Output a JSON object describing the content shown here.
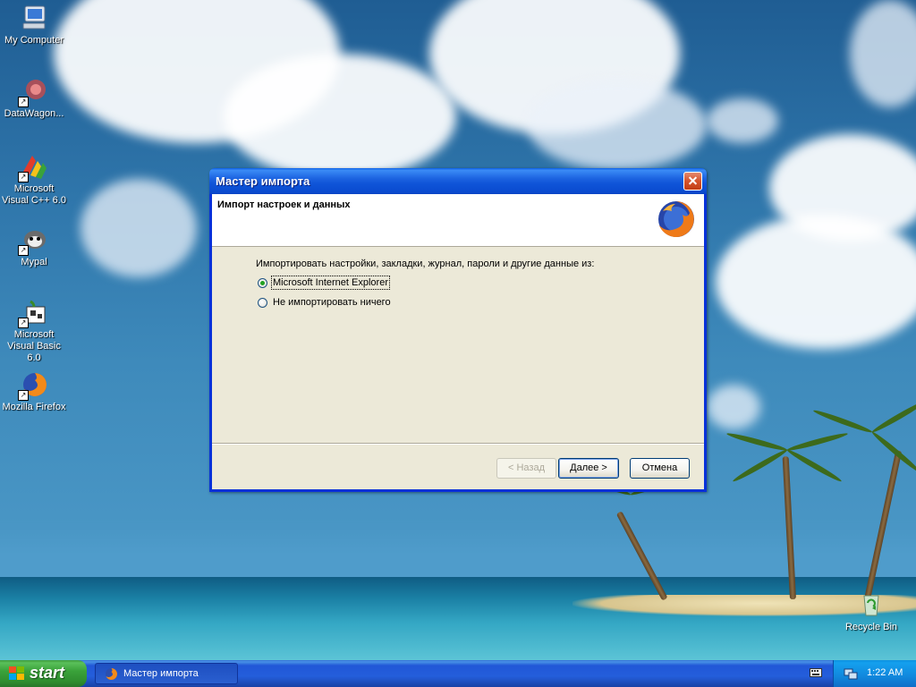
{
  "desktop": {
    "icons": [
      {
        "label": "My Computer",
        "icon": "my-computer-icon"
      },
      {
        "label": "DataWagon...",
        "icon": "datawagon-icon"
      },
      {
        "label": "Microsoft Visual C++ 6.0",
        "icon": "visual-cpp-icon"
      },
      {
        "label": "Mypal",
        "icon": "mypal-icon"
      },
      {
        "label": "Microsoft Visual Basic 6.0",
        "icon": "visual-basic-icon"
      },
      {
        "label": "Mozilla Firefox",
        "icon": "firefox-icon"
      },
      {
        "label": "Recycle Bin",
        "icon": "recycle-bin-icon"
      }
    ]
  },
  "dialog": {
    "title": "Мастер импорта",
    "header_title": "Импорт настроек и данных",
    "prompt": "Импортировать настройки, закладки, журнал, пароли и другие данные из:",
    "options": [
      {
        "label": "Microsoft Internet Explorer",
        "selected": true
      },
      {
        "label": "Не импортировать ничего",
        "selected": false
      }
    ],
    "buttons": {
      "back": "< Назад",
      "next": "Далее >",
      "cancel": "Отмена"
    }
  },
  "taskbar": {
    "start_label": "start",
    "task_label": "Мастер импорта",
    "clock": "1:22 AM"
  },
  "colors": {
    "title_bar": "#0a4bd0",
    "dialog_face": "#ece9d8",
    "taskbar": "#245edb",
    "start_button": "#3aa23a"
  }
}
